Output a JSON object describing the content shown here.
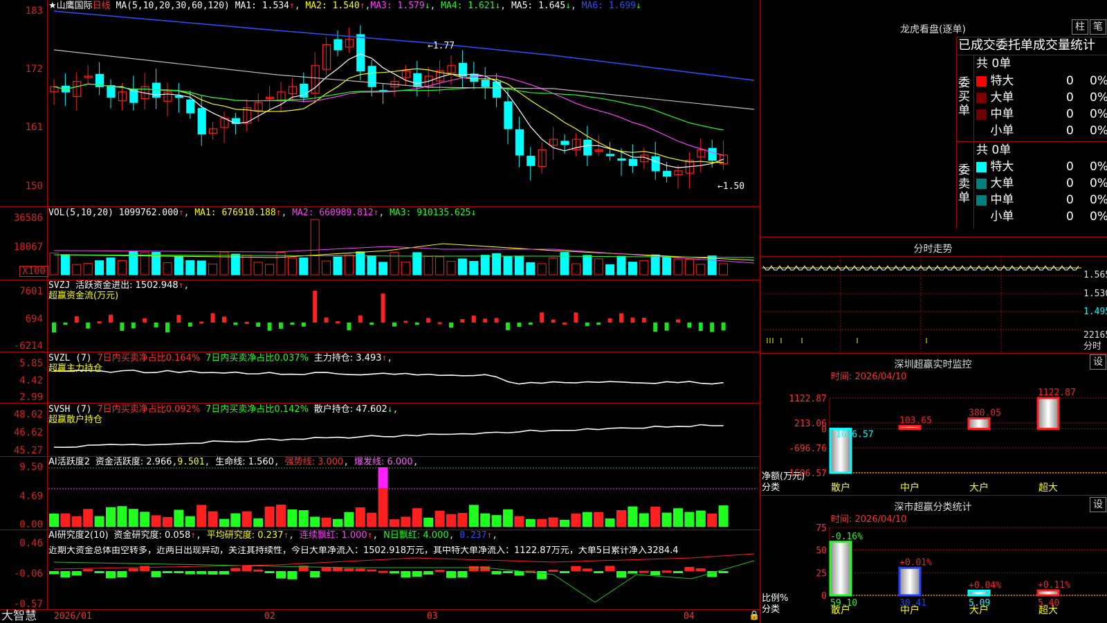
{
  "app_name": "大智慧",
  "colors": {
    "up": "#ff2020",
    "down": "#00ffff",
    "grid": "#b00000",
    "ma1": "#ffffff",
    "ma2": "#ffff00",
    "ma3": "#ff40ff",
    "ma4": "#20ff20",
    "ma5": "#c0c0c0",
    "ma6": "#3050ff"
  },
  "main": {
    "stock": "★山鹰国际",
    "period": "日线",
    "ma_params": "MA(5,10,20,30,60,120)",
    "ma1": "MA1: 1.534",
    "ma2": "MA2: 1.540",
    "ma3": "MA3: 1.579",
    "ma4": "MA4: 1.621",
    "ma5": "MA5: 1.645",
    "ma6": "MA6: 1.699",
    "y_labels": [
      "183",
      "172",
      "161",
      "150"
    ],
    "high_marker": "1.77",
    "low_marker": "1.50"
  },
  "vol": {
    "params": "VOL(5,10,20)",
    "value": "1099762.000",
    "ma1": "MA1: 676910.188",
    "ma2": "MA2: 660989.812",
    "ma3": "MA3: 910135.625",
    "y_labels": [
      "36586",
      "18067",
      "X100"
    ]
  },
  "svzj": {
    "title": "SVZJ",
    "active_fund": "活跃资金进出: 1502.948",
    "sub": "超赢资金流(万元)",
    "y_labels": [
      "7601",
      "694",
      "-6214"
    ]
  },
  "svzl": {
    "title": "SVZL (7)",
    "pct7a": "7日内买卖净占比0.164%",
    "pct7b": "7日内买卖净占比0.037%",
    "hold": "主力持仓: 3.493",
    "sub": "超赢主力持仓",
    "y_labels": [
      "5.85",
      "4.42",
      "2.99"
    ]
  },
  "svsh": {
    "title": "SVSH (7)",
    "pct7a": "7日内买卖净占比0.092%",
    "pct7b": "7日内买卖净占比0.142%",
    "hold": "散户持仓: 47.602",
    "sub": "超赢散户持仓",
    "y_labels": [
      "48.02",
      "46.62",
      "45.27"
    ]
  },
  "ai1": {
    "title": "AI活跃度2",
    "fund": "资金活跃度: 2.966",
    "v2": "9.501",
    "life": "生命线: 1.560",
    "strong": "强势线: 3.000",
    "burst": "爆发线: 6.000",
    "y_labels": [
      "9.50",
      "4.69",
      "0.00"
    ]
  },
  "ai2": {
    "title": "AI研究度2(10)",
    "fund": "资金研究度: 0.058",
    "avg": "平均研究度: 0.237",
    "cont": "连续飘红: 1.000",
    "nday": "N日飘红: 4.000",
    "v5": "0.237",
    "comment": "近期大资金总体由空转多，近两日出现异动，关注其持续性，今日大单净流入：1502.918万元，其中特大单净流入：1122.87万元，大单5日累计净入3284.4",
    "y_labels": [
      "0.46",
      "-0.06",
      "-0.57"
    ]
  },
  "x_labels": [
    "2026/01",
    "02",
    "03",
    "04"
  ],
  "longhu": {
    "title": "龙虎看盘(逐单)",
    "btn_zhu": "柱",
    "btn_bi": "笔",
    "header": "已成交委托单成交量统计",
    "buy_label": "委买单",
    "sell_label": "委卖单",
    "buy_total": "共 0单",
    "sell_total": "共 0单",
    "buy_rows": [
      {
        "name": "特大",
        "n": "0",
        "p": "0%",
        "c": "#ff0000"
      },
      {
        "name": "大单",
        "n": "0",
        "p": "0%",
        "c": "#800000"
      },
      {
        "name": "中单",
        "n": "0",
        "p": "0%",
        "c": "#700000"
      },
      {
        "name": "小单",
        "n": "0",
        "p": "0%",
        "c": ""
      }
    ],
    "sell_rows": [
      {
        "name": "特大",
        "n": "0",
        "p": "0%",
        "c": "#00ffff"
      },
      {
        "name": "大单",
        "n": "0",
        "p": "0%",
        "c": "#008080"
      },
      {
        "name": "中单",
        "n": "0",
        "p": "0%",
        "c": "#008080"
      },
      {
        "name": "小单",
        "n": "0",
        "p": "0%",
        "c": ""
      }
    ]
  },
  "fenshi": {
    "title": "分时走势",
    "prices": [
      "1.565",
      "1.530",
      "1.495"
    ],
    "vol_label": "22165",
    "vol_unit": "分时"
  },
  "sz_monitor": {
    "title": "深圳超赢实时监控",
    "btn": "设",
    "date": "时间: 2026/04/10",
    "y_labels": [
      "1122.87",
      "213.06",
      "0",
      "-696.76",
      "-1606.57"
    ],
    "ylabel1": "净额(万元)",
    "ylabel2": "分类",
    "chart_data": {
      "type": "bar",
      "categories": [
        "散户",
        "中户",
        "大户",
        "超大"
      ],
      "values": [
        -1606.57,
        103.65,
        380.05,
        1122.87
      ],
      "value_labels": [
        "-1606.57",
        "103.65",
        "380.05",
        "1122.87"
      ],
      "ylim": [
        -1606.57,
        1122.87
      ]
    }
  },
  "sz_class": {
    "title": "深市超赢分类统计",
    "btn": "设",
    "date": "时间: 2026/04/10",
    "y_labels": [
      "75",
      "50",
      "25",
      "0"
    ],
    "ylabel1": "比例%",
    "ylabel2": "分类",
    "chart_data": {
      "type": "bar",
      "categories": [
        "散户",
        "中户",
        "大户",
        "超大"
      ],
      "values": [
        59.1,
        30.41,
        5.09,
        5.4
      ],
      "changes": [
        "-0.16%",
        "+0.01%",
        "+0.04%",
        "+0.11%"
      ],
      "value_labels": [
        "59.10",
        "30.41",
        "5.09",
        "5.40"
      ],
      "ylim": [
        0,
        75
      ]
    }
  }
}
